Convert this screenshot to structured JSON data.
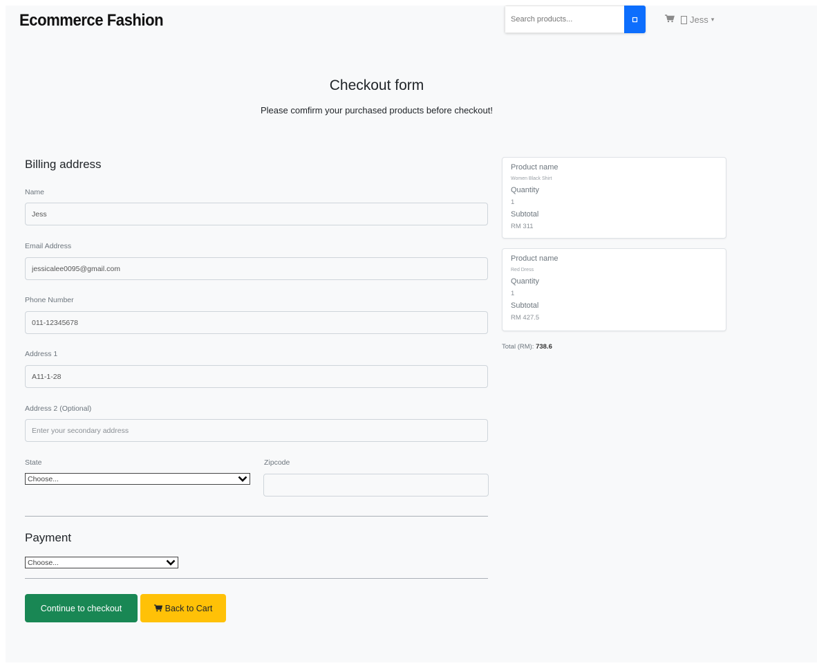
{
  "header": {
    "brand": "Ecommerce Fashion",
    "search_placeholder": "Search products...",
    "user_name": "Jess"
  },
  "main": {
    "title": "Checkout form",
    "subtitle": "Please comfirm your purchased products before checkout!"
  },
  "billing": {
    "title": "Billing address",
    "name_label": "Name",
    "name_value": "Jess",
    "email_label": "Email Address",
    "email_value": "jessicalee0095@gmail.com",
    "phone_label": "Phone Number",
    "phone_value": "011-12345678",
    "address1_label": "Address 1",
    "address1_value": "A11-1-28",
    "address2_label": "Address 2 (Optional)",
    "address2_placeholder": "Enter your secondary address",
    "state_label": "State",
    "state_value": "Choose...",
    "zipcode_label": "Zipcode",
    "zipcode_value": ""
  },
  "payment": {
    "title": "Payment",
    "value": "Choose..."
  },
  "actions": {
    "checkout_label": "Continue to checkout",
    "back_label": "Back to Cart"
  },
  "cart": {
    "items": [
      {
        "name_label": "Product name",
        "name": "Women Black Shirt",
        "qty_label": "Quantity",
        "qty": "1",
        "subtotal_label": "Subtotal",
        "subtotal": "RM 311"
      },
      {
        "name_label": "Product name",
        "name": "Red Dress",
        "qty_label": "Quantity",
        "qty": "1",
        "subtotal_label": "Subtotal",
        "subtotal": "RM 427.5"
      }
    ],
    "total_label": "Total (RM):",
    "total_value": "738.6"
  },
  "colors": {
    "primary": "#0d6efd",
    "success": "#198754",
    "warning": "#ffc107",
    "background": "#f8f9fa"
  },
  "icons": {
    "search": "search-icon",
    "cart": "cart-icon",
    "user": "user-icon",
    "dropdown": "chevron-down-icon"
  }
}
